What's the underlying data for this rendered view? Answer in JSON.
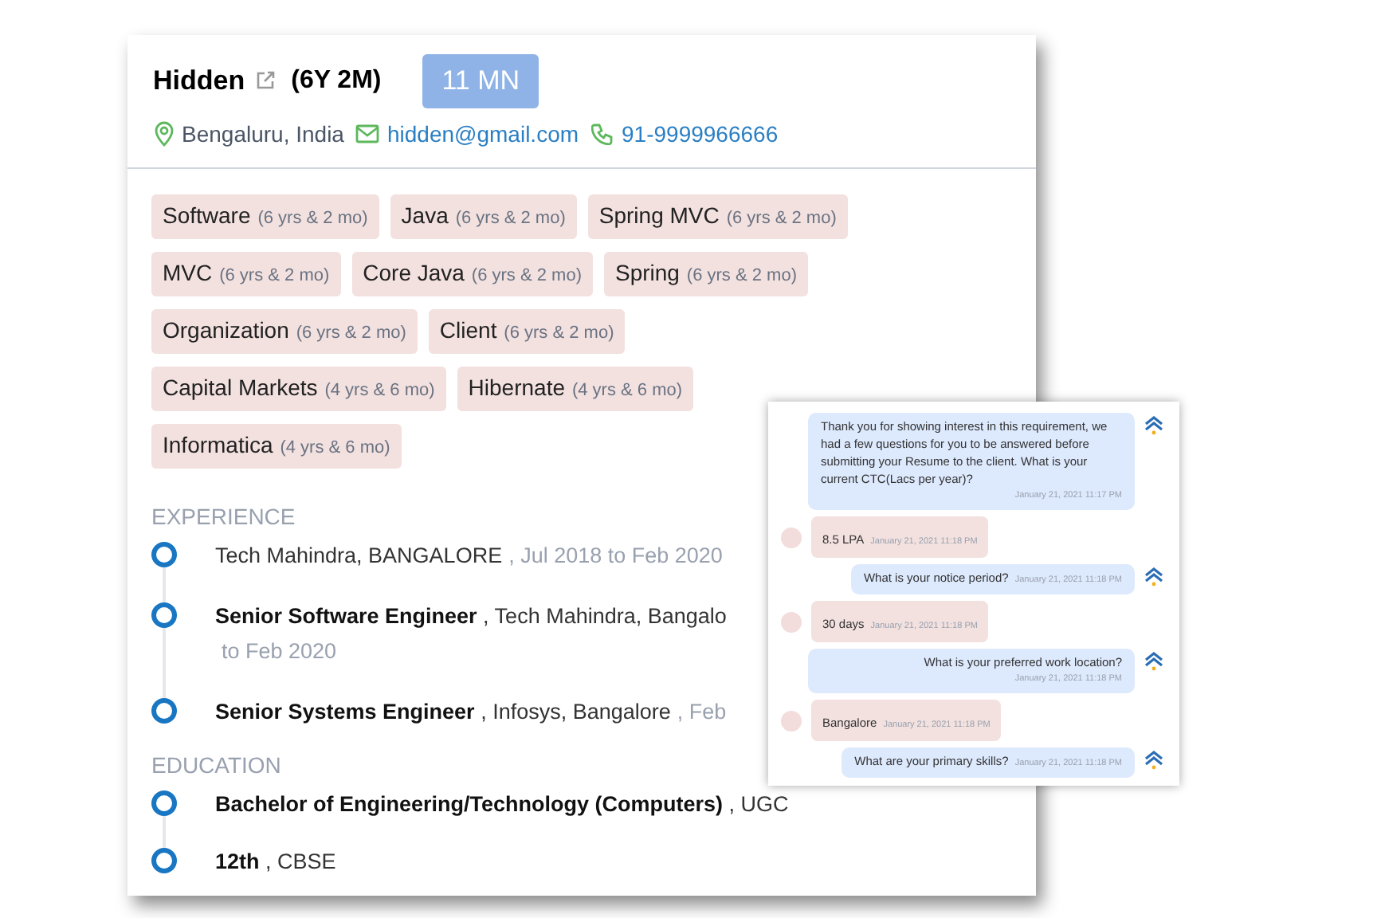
{
  "candidate": {
    "name": "Hidden",
    "experience": "(6Y 2M)",
    "badge": "11 MN",
    "location": "Bengaluru, India",
    "email": "hidden@gmail.com",
    "phone": "91-9999966666"
  },
  "skills": [
    {
      "name": "Software",
      "duration": "(6 yrs & 2 mo)"
    },
    {
      "name": "Java",
      "duration": "(6 yrs & 2 mo)"
    },
    {
      "name": "Spring MVC",
      "duration": "(6 yrs & 2 mo)"
    },
    {
      "name": "MVC",
      "duration": "(6 yrs & 2 mo)"
    },
    {
      "name": "Core Java",
      "duration": "(6 yrs & 2 mo)"
    },
    {
      "name": "Spring",
      "duration": "(6 yrs & 2 mo)"
    },
    {
      "name": "Organization",
      "duration": "(6 yrs & 2 mo)"
    },
    {
      "name": "Client",
      "duration": "(6 yrs & 2 mo)"
    },
    {
      "name": "Capital Markets",
      "duration": "(4 yrs & 6 mo)"
    },
    {
      "name": "Hibernate",
      "duration": "(4 yrs & 6 mo)"
    },
    {
      "name": "Informatica",
      "duration": "(4 yrs & 6 mo)"
    }
  ],
  "experience_heading": "EXPERIENCE",
  "experience": [
    {
      "org": "Tech Mahindra, BANGALORE",
      "date": ", Jul 2018 to Feb 2020"
    },
    {
      "title": "Senior Software Engineer",
      "org": ", Tech Mahindra, Bangalo",
      "date": "to Feb 2020"
    },
    {
      "title": "Senior Systems Engineer",
      "org": ", Infosys, Bangalore",
      "date": ", Feb"
    }
  ],
  "education_heading": "EDUCATION",
  "education": [
    {
      "title": "Bachelor of Engineering/Technology (Computers)",
      "org": ", UGC"
    },
    {
      "title": "12th",
      "org": ", CBSE"
    }
  ],
  "chat": [
    {
      "kind": "bot",
      "text": "Thank you for showing interest in this requirement, we had a few questions for you to be answered before submitting your Resume to the client. What is your current CTC(Lacs per year)?",
      "time": "January 21, 2021 11:17 PM"
    },
    {
      "kind": "user",
      "text": "8.5 LPA",
      "time": "January 21, 2021 11:18 PM"
    },
    {
      "kind": "bot",
      "text": "What is your notice period?",
      "time": "January 21, 2021 11:18 PM"
    },
    {
      "kind": "user",
      "text": "30 days",
      "time": "January 21, 2021 11:18 PM"
    },
    {
      "kind": "bot",
      "text": "What is your preferred work location?",
      "time": "January 21, 2021 11:18 PM"
    },
    {
      "kind": "user",
      "text": "Bangalore",
      "time": "January 21, 2021 11:18 PM"
    },
    {
      "kind": "bot",
      "text": "What are your primary skills?",
      "time": "January 21, 2021 11:18 PM"
    }
  ]
}
